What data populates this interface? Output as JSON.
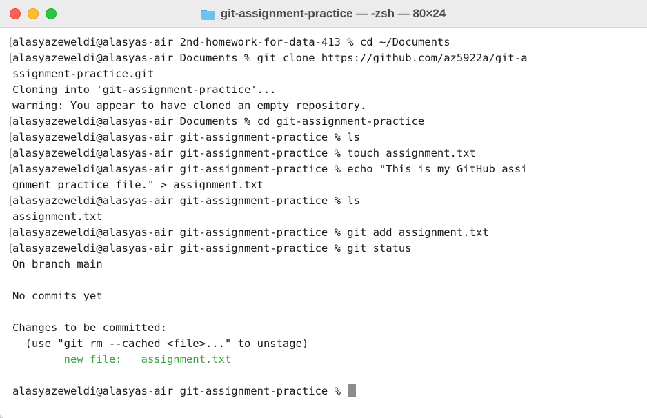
{
  "window": {
    "title": "git-assignment-practice — -zsh — 80×24",
    "title_icon": "folder-icon",
    "traffic_lights": {
      "close": "#fe5f57",
      "minimize": "#febc2e",
      "zoom": "#28c840"
    }
  },
  "colors": {
    "text": "#1a1a1a",
    "added_file": "#3aa23a",
    "cursor": "#8c8c8c"
  },
  "terminal": {
    "lines": [
      {
        "text": "alasyazeweldi@alasyas-air 2nd-homework-for-data-413 % cd ~/Documents",
        "marker": true
      },
      {
        "text": "alasyazeweldi@alasyas-air Documents % git clone https://github.com/az5922a/git-a",
        "marker": true
      },
      {
        "text": "ssignment-practice.git"
      },
      {
        "text": "Cloning into 'git-assignment-practice'..."
      },
      {
        "text": "warning: You appear to have cloned an empty repository."
      },
      {
        "text": "alasyazeweldi@alasyas-air Documents % cd git-assignment-practice",
        "marker": true
      },
      {
        "text": "alasyazeweldi@alasyas-air git-assignment-practice % ls",
        "marker": true
      },
      {
        "text": "alasyazeweldi@alasyas-air git-assignment-practice % touch assignment.txt",
        "marker": true
      },
      {
        "text": "alasyazeweldi@alasyas-air git-assignment-practice % echo \"This is my GitHub assi",
        "marker": true
      },
      {
        "text": "gnment practice file.\" > assignment.txt"
      },
      {
        "text": "alasyazeweldi@alasyas-air git-assignment-practice % ls",
        "marker": true
      },
      {
        "text": "assignment.txt"
      },
      {
        "text": "alasyazeweldi@alasyas-air git-assignment-practice % git add assignment.txt",
        "marker": true
      },
      {
        "text": "alasyazeweldi@alasyas-air git-assignment-practice % git status",
        "marker": true
      },
      {
        "text": "On branch main"
      },
      {
        "text": ""
      },
      {
        "text": "No commits yet"
      },
      {
        "text": ""
      },
      {
        "text": "Changes to be committed:"
      },
      {
        "text": "  (use \"git rm --cached <file>...\" to unstage)"
      },
      {
        "text": "        new file:   assignment.txt",
        "green": true
      },
      {
        "text": ""
      }
    ],
    "prompt": "alasyazeweldi@alasyas-air git-assignment-practice % ",
    "marker_char": "["
  }
}
